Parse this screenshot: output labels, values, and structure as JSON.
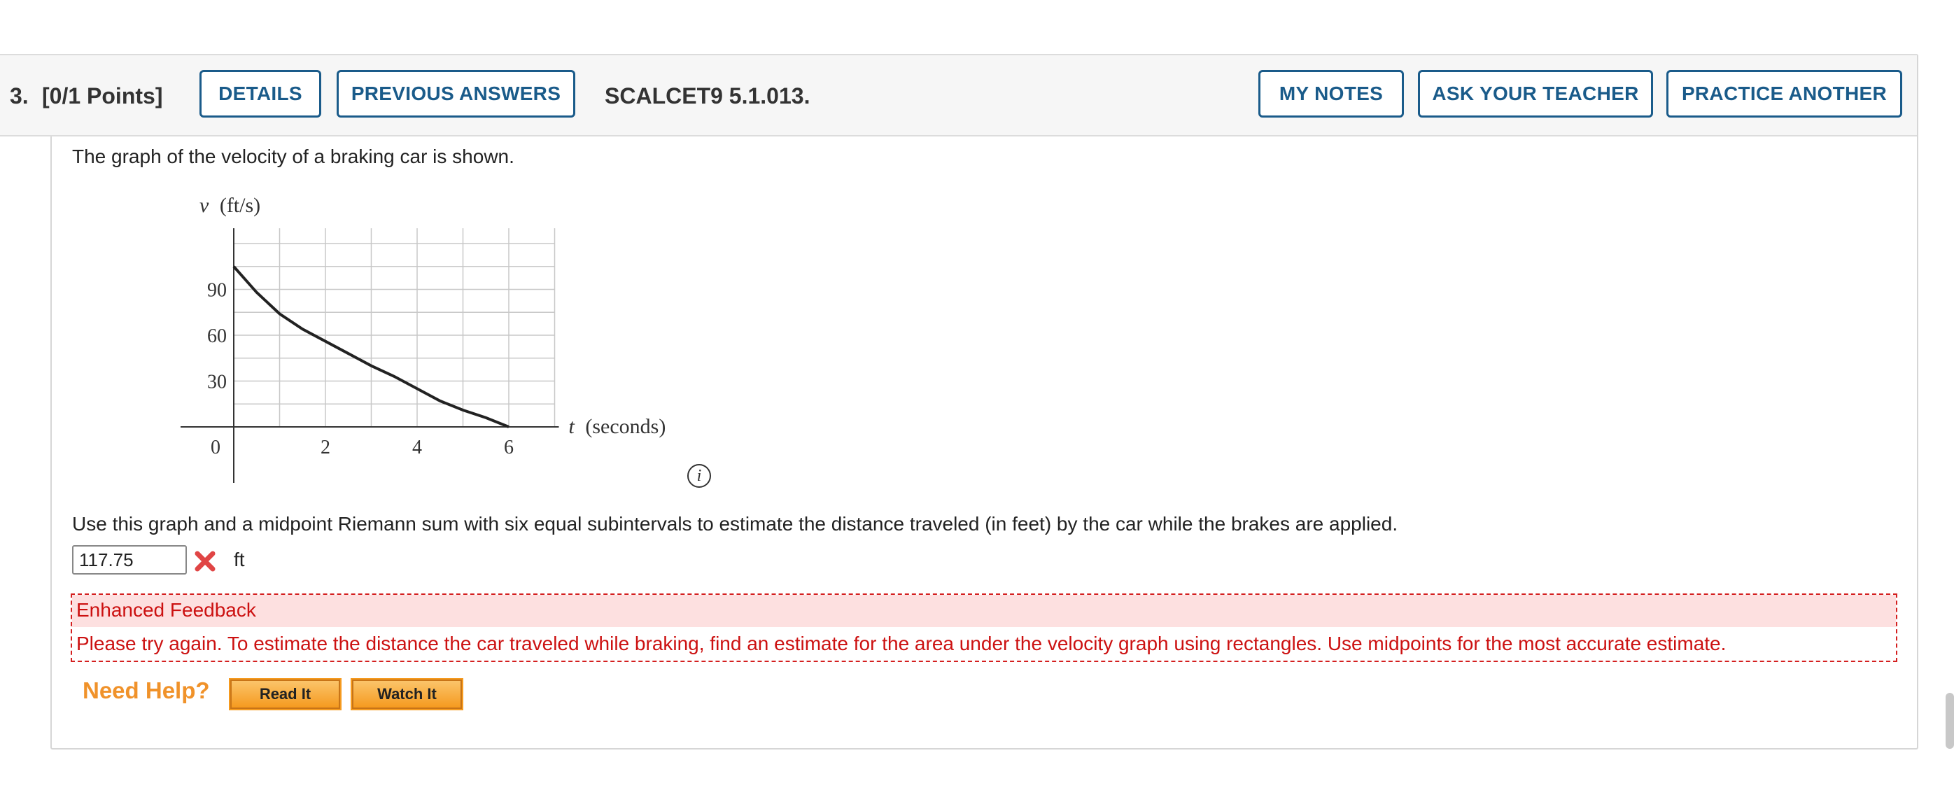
{
  "header": {
    "number": "3.",
    "points": "[0/1 Points]",
    "details_label": "DETAILS",
    "previous_answers_label": "PREVIOUS ANSWERS",
    "code": "SCALCET9 5.1.013.",
    "my_notes_label": "MY NOTES",
    "ask_teacher_label": "ASK YOUR TEACHER",
    "practice_another_label": "PRACTICE ANOTHER"
  },
  "intro_text": "The graph of the velocity of a braking car is shown.",
  "chart_data": {
    "type": "line",
    "ylabel_var": "v",
    "ylabel_unit": "(ft/s)",
    "xlabel_var": "t",
    "xlabel_unit": "(seconds)",
    "x_ticks": [
      "2",
      "4",
      "6"
    ],
    "y_ticks": [
      "90",
      "60",
      "30"
    ],
    "origin_label": "0",
    "xlim": [
      0,
      7
    ],
    "ylim": [
      0,
      130
    ],
    "grid": true,
    "series": [
      {
        "x": [
          0,
          0.5,
          1,
          1.5,
          2,
          2.5,
          3,
          3.5,
          4,
          4.5,
          5,
          5.5,
          6
        ],
        "y": [
          105,
          88,
          74,
          64,
          56,
          48,
          40,
          33,
          25,
          17,
          11,
          6,
          0
        ]
      }
    ]
  },
  "info_icon": "i",
  "question_text": "Use this graph and a midpoint Riemann sum with six equal subintervals to estimate the distance traveled (in feet) by the car while the brakes are applied.",
  "answer": {
    "value": "117.75",
    "unit": "ft",
    "status": "incorrect"
  },
  "feedback": {
    "title": "Enhanced Feedback",
    "text": "Please try again. To estimate the distance the car traveled while braking, find an estimate for the area under the velocity graph using rectangles. Use midpoints for the most accurate estimate."
  },
  "help": {
    "label": "Need Help?",
    "read_it_label": "Read It",
    "watch_it_label": "Watch It"
  },
  "colors": {
    "button_border": "#1a5b8a",
    "error_red": "#cc1111",
    "feedback_bg": "#fde0e0",
    "help_orange": "#f0922a"
  }
}
